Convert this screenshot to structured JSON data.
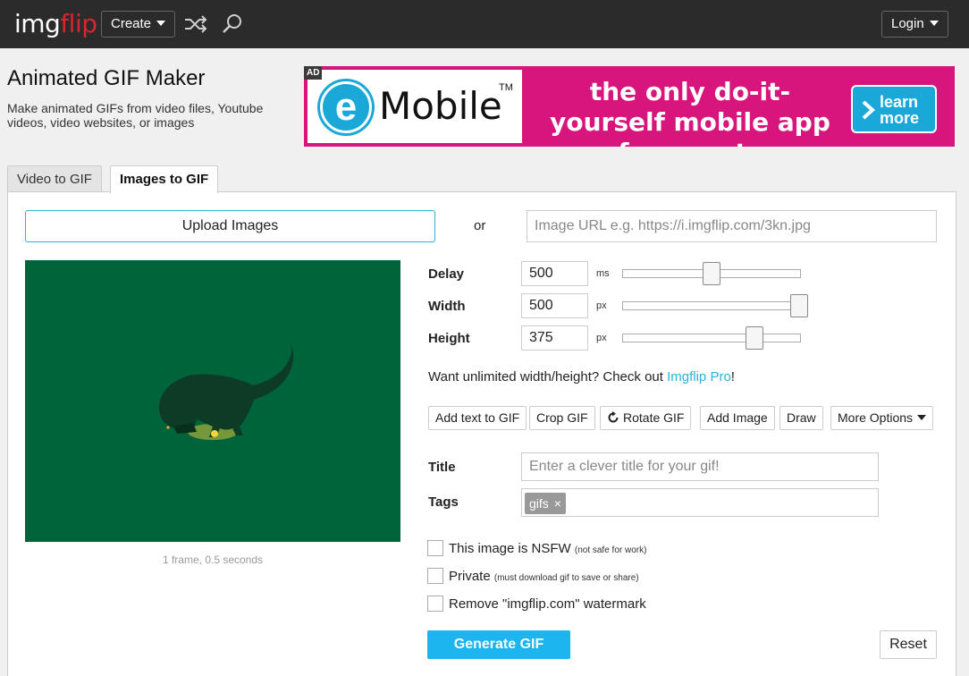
{
  "header": {
    "logo_part1": "img",
    "logo_part2": "flip",
    "create_label": "Create",
    "login_label": "Login",
    "icons": [
      "shuffle-icon",
      "search-icon"
    ]
  },
  "page": {
    "title": "Animated GIF Maker",
    "description": "Make animated GIFs from video files, Youtube videos, video websites, or images"
  },
  "ad": {
    "badge": "AD",
    "logo_letter": "e",
    "brand": "Mobile",
    "trademark": "TM",
    "tagline": "the only do-it-yourself mobile app for events",
    "cta": "learn more"
  },
  "tabs": [
    {
      "label": "Video to GIF",
      "active": false
    },
    {
      "label": "Images to GIF",
      "active": true
    }
  ],
  "upload": {
    "button_label": "Upload Images",
    "or_label": "or",
    "url_placeholder": "Image URL e.g. https://i.imgflip.com/3kn.jpg"
  },
  "preview": {
    "caption": "1 frame, 0.5 seconds"
  },
  "options": {
    "delay": {
      "label": "Delay",
      "value": "500",
      "unit": "ms",
      "slider_level": 0.5
    },
    "width": {
      "label": "Width",
      "value": "500",
      "unit": "px",
      "slider_level": 1.0
    },
    "height": {
      "label": "Height",
      "value": "375",
      "unit": "px",
      "slider_level": 0.74
    }
  },
  "pro": {
    "text": "Want unlimited width/height? Check out ",
    "link": "Imgflip Pro",
    "suffix": "!"
  },
  "tools": {
    "add_text": "Add text to GIF",
    "crop": "Crop GIF",
    "rotate": "Rotate GIF",
    "add_image": "Add Image",
    "draw": "Draw",
    "more": "More Options"
  },
  "meta": {
    "title_label": "Title",
    "title_placeholder": "Enter a clever title for your gif!",
    "tags_label": "Tags",
    "tag_chip": "gifs",
    "tag_remove": "×"
  },
  "checks": {
    "nsfw_label": "This image is NSFW",
    "nsfw_note": "(not safe for work)",
    "private_label": "Private",
    "private_note": "(must download gif to save or share)",
    "watermark_label": "Remove \"imgflip.com\" watermark"
  },
  "actions": {
    "generate": "Generate GIF",
    "reset": "Reset"
  },
  "colors": {
    "topbar": "#2b2b2b",
    "logo_accent": "#d9262c",
    "accent": "#1cb5f0",
    "ad_background": "#d8157c",
    "preview_background": "#00643a"
  }
}
